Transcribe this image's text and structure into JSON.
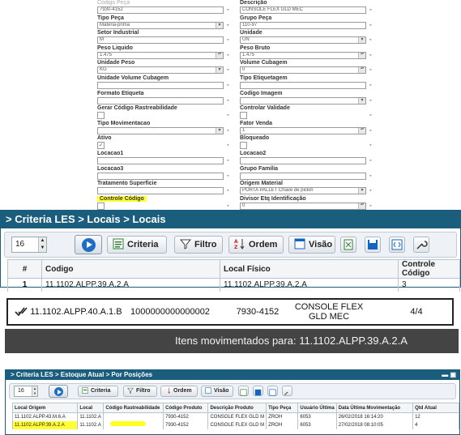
{
  "form": {
    "left": [
      {
        "label": "Código Peça",
        "value": "7930-4152",
        "kind": "text",
        "faded": true
      },
      {
        "label": "Tipo Peça",
        "value": "Matéria-prima",
        "kind": "select"
      },
      {
        "label": "Setor Industrial",
        "value": "M",
        "kind": "text"
      },
      {
        "label": "Peso Liquido",
        "value": "1.475",
        "kind": "spin"
      },
      {
        "label": "Unidade Peso",
        "value": "KG",
        "kind": "select"
      },
      {
        "label": "Unidade Volume Cubagem",
        "value": "",
        "kind": "text"
      },
      {
        "label": "Formato Etiqueta",
        "value": "",
        "kind": "text"
      },
      {
        "label": "Gerar Código Rastreabilidade",
        "value": "",
        "kind": "check"
      },
      {
        "label": "Tipo Movimentacao",
        "value": "",
        "kind": "select"
      },
      {
        "label": "Ativo",
        "value": "✓",
        "kind": "check"
      },
      {
        "label": "Locacao1",
        "value": "",
        "kind": "text"
      },
      {
        "label": "Locacao3",
        "value": "",
        "kind": "text"
      },
      {
        "label": "Tratamento Superficie",
        "value": "",
        "kind": "text"
      },
      {
        "label": "Controle Código",
        "value": "",
        "kind": "check",
        "highlight": true
      }
    ],
    "right": [
      {
        "label": "Descrição",
        "value": "CONSOLE FLEX GLD MEC",
        "kind": "text"
      },
      {
        "label": "Grupo Peça",
        "value": "110-97",
        "kind": "text"
      },
      {
        "label": "Unidade",
        "value": "UN",
        "kind": "select"
      },
      {
        "label": "Peso Bruto",
        "value": "1.475",
        "kind": "spin"
      },
      {
        "label": "Volume Cubagem",
        "value": "0",
        "kind": "spin"
      },
      {
        "label": "Tipo Etiquetagem",
        "value": "",
        "kind": "text"
      },
      {
        "label": "Codigo Imagem",
        "value": "",
        "kind": "select"
      },
      {
        "label": "Controlar Validade",
        "value": "",
        "kind": "check"
      },
      {
        "label": "Fator Venda",
        "value": "1",
        "kind": "spin"
      },
      {
        "label": "Bloqueado",
        "value": "",
        "kind": "check"
      },
      {
        "label": "Locacao2",
        "value": "",
        "kind": "text"
      },
      {
        "label": "Grupo Familia",
        "value": "",
        "kind": "text"
      },
      {
        "label": "Origem Material",
        "value": "PORTA PALLET Chave de pickin",
        "kind": "select"
      },
      {
        "label": "Divisor Etq Identificação",
        "value": "0",
        "kind": "spin"
      }
    ]
  },
  "locais": {
    "title": "> Criteria LES > Locais > Locais",
    "page_size": "16",
    "buttons": {
      "criteria": "Criteria",
      "filtro": "Filtro",
      "ordem": "Ordem",
      "visao": "Visão"
    },
    "columns": [
      "#",
      "Codigo",
      "Local Físico",
      "Controle Código"
    ],
    "rows": [
      {
        "num": "1",
        "codigo": "11.1102.ALPP.39.A.2.A",
        "local": "11.1102.ALPP.39.A.2.A",
        "controle": "3"
      }
    ]
  },
  "inforow": {
    "local": "11.1102.ALPP.40.A.1.B",
    "code": "1000000000000002",
    "part": "7930-4152",
    "desc": "CONSOLE FLEX GLD MEC",
    "count": "4/4"
  },
  "toast": {
    "text": "Itens movimentados para: 11.1102.ALPP.39.A.2.A"
  },
  "estoque": {
    "title": "> Criteria LES > Estoque Atual > Por Posições",
    "page_size": "16",
    "buttons": {
      "criteria": "Criteria",
      "filtro": "Filtro",
      "ordem": "Ordem",
      "visao": "Visão"
    },
    "columns": [
      "Local Origem",
      "Local",
      "Código Rastreabilidade",
      "Código Produto",
      "Descrição Produto",
      "Tipo Peça",
      "Usuário Última",
      "Data Última Movimentação",
      "Qtd Atual"
    ],
    "rows": [
      [
        "11.1102.ALPP.43.M.6.A",
        "11.1102.A",
        "",
        "7930-4152",
        "CONSOLE FLEX GLD M",
        "ZROH",
        "6053",
        "26/02/2018 16:14:20",
        "12"
      ],
      [
        "11.1102.ALPP.39.A.2.A",
        "11.1102.A",
        "",
        "7930-4152",
        "CONSOLE FLEX GLD M",
        "ZROH",
        "6053",
        "27/02/2018 08:10:05",
        "4"
      ]
    ]
  }
}
